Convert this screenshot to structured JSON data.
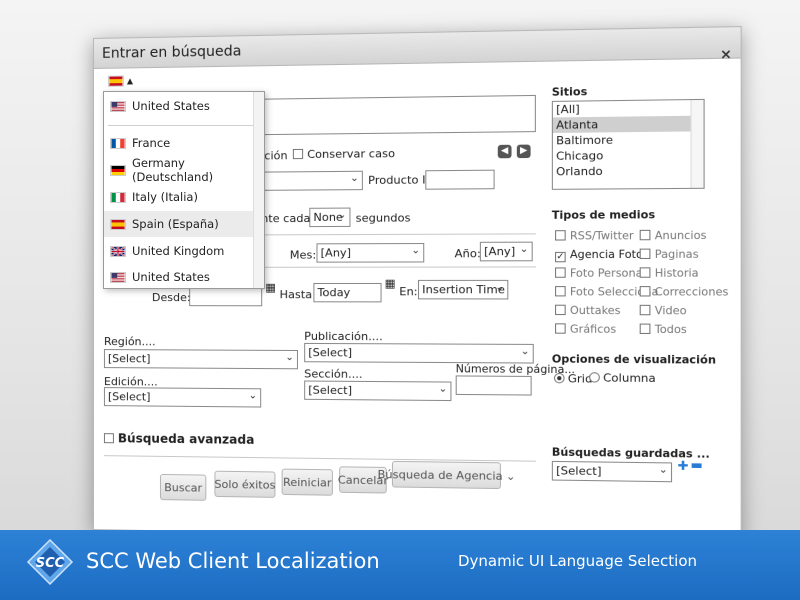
{
  "dialog": {
    "title": "Entrar en búsqueda",
    "close": "×"
  },
  "language_dropdown": {
    "items": [
      {
        "label": "United States",
        "flag": "us"
      },
      {
        "label": "France",
        "flag": "fr"
      },
      {
        "label": "Germany (Deutschland)",
        "flag": "de"
      },
      {
        "label": "Italy (Italia)",
        "flag": "it"
      },
      {
        "label": "Spain (España)",
        "flag": "es"
      },
      {
        "label": "United Kingdom",
        "flag": "uk"
      },
      {
        "label": "United States",
        "flag": "us"
      }
    ]
  },
  "form": {
    "case_frag": "ición",
    "keep_case": "Conservar caso",
    "product_id_label": "Producto ID:",
    "product_select": "",
    "refresh_frag": "nte cada",
    "refresh_value": "None",
    "refresh_unit": "segundos",
    "month_label": "Mes:",
    "month_value": "[Any]",
    "year_label": "Año:",
    "year_value": "[Any]",
    "from_label": "Desde:",
    "to_label": "Hasta:",
    "to_value": "Today",
    "on_label": "En:",
    "on_value": "Insertion Time",
    "region_label": "Región....",
    "region_value": "[Select]",
    "publication_label": "Publicación....",
    "publication_value": "[Select]",
    "edition_label": "Edición....",
    "edition_value": "[Select]",
    "section_label": "Sección....",
    "section_value": "[Select]",
    "pages_label": "Números de página...",
    "advanced_label": "Búsqueda avanzada"
  },
  "buttons": {
    "search": "Buscar",
    "hits_only": "Solo éxitos",
    "reset": "Reiniciar",
    "cancel": "Cancelar",
    "agency_search": "Búsqueda de Agencia"
  },
  "sites": {
    "label": "Sitios",
    "items": [
      "[All]",
      "Atlanta",
      "Baltimore",
      "Chicago",
      "Orlando"
    ],
    "selected": "Atlanta"
  },
  "media_types": {
    "label": "Tipos de medios",
    "left": [
      {
        "label": "RSS/Twitter",
        "checked": false
      },
      {
        "label": "Agencia Foto",
        "checked": true
      },
      {
        "label": "Foto Personal",
        "checked": false
      },
      {
        "label": "Foto Selecciona",
        "checked": false
      },
      {
        "label": "Outtakes",
        "checked": false
      },
      {
        "label": "Gráficos",
        "checked": false
      }
    ],
    "right": [
      {
        "label": "Anuncios",
        "checked": false
      },
      {
        "label": "Paginas",
        "checked": false
      },
      {
        "label": "Historia",
        "checked": false
      },
      {
        "label": "Correcciones",
        "checked": false
      },
      {
        "label": "Video",
        "checked": false
      },
      {
        "label": "Todos",
        "checked": false
      }
    ]
  },
  "display_options": {
    "label": "Opciones de visualización",
    "grid": "Grid",
    "column": "Columna",
    "selected": "Grid"
  },
  "saved_searches": {
    "label": "Búsquedas guardadas ...",
    "value": "[Select]"
  },
  "banner": {
    "logo_text": "SCC",
    "product": "SCC Web Client Localization",
    "tagline": "Dynamic UI Language Selection"
  },
  "colors": {
    "banner_blue": "#2277cc",
    "nav_gray": "#555555"
  }
}
